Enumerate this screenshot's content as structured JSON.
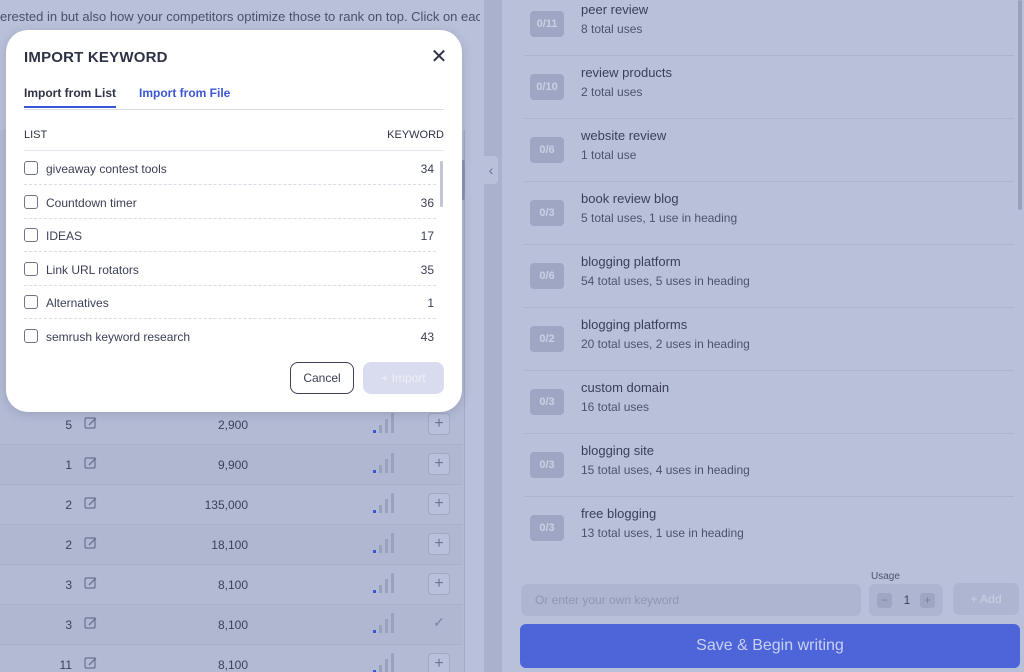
{
  "intro_text": "erested in but also how your competitors optimize those to rank on top. Click on each",
  "table_rows": [
    {
      "num": "5",
      "volume": "2,900",
      "action": "add"
    },
    {
      "num": "1",
      "volume": "9,900",
      "action": "add"
    },
    {
      "num": "2",
      "volume": "135,000",
      "action": "add"
    },
    {
      "num": "2",
      "volume": "18,100",
      "action": "add"
    },
    {
      "num": "3",
      "volume": "8,100",
      "action": "add"
    },
    {
      "num": "3",
      "volume": "8,100",
      "action": "added"
    },
    {
      "num": "11",
      "volume": "8,100",
      "action": "add"
    }
  ],
  "keywords": [
    {
      "badge": "0/11",
      "name": "peer review",
      "uses": "8 total uses"
    },
    {
      "badge": "0/10",
      "name": "review products",
      "uses": "2 total uses"
    },
    {
      "badge": "0/6",
      "name": "website review",
      "uses": "1 total use"
    },
    {
      "badge": "0/3",
      "name": "book review blog",
      "uses": "5 total uses, 1 use in heading"
    },
    {
      "badge": "0/6",
      "name": "blogging platform",
      "uses": "54 total uses, 5 uses in heading"
    },
    {
      "badge": "0/2",
      "name": "blogging platforms",
      "uses": "20 total uses, 2 uses in heading"
    },
    {
      "badge": "0/3",
      "name": "custom domain",
      "uses": "16 total uses"
    },
    {
      "badge": "0/3",
      "name": "blogging site",
      "uses": "15 total uses, 4 uses in heading"
    },
    {
      "badge": "0/3",
      "name": "free blogging",
      "uses": "13 total uses, 1 use in heading"
    }
  ],
  "own_keyword": {
    "placeholder": "Or enter your own keyword"
  },
  "usage": {
    "label": "Usage",
    "value": "1",
    "minus": "−",
    "plus": "+"
  },
  "add_label": "+ Add",
  "save_label": "Save & Begin writing",
  "collapse_glyph": "‹",
  "modal": {
    "title": "IMPORT KEYWORD",
    "close_glyph": "✕",
    "tabs": [
      "Import from List",
      "Import from File"
    ],
    "col_list": "LIST",
    "col_keyword": "KEYWORD",
    "lists": [
      {
        "name": "giveaway contest tools",
        "count": "34"
      },
      {
        "name": "Countdown timer",
        "count": "36"
      },
      {
        "name": "IDEAS",
        "count": "17"
      },
      {
        "name": "Link URL rotators",
        "count": "35"
      },
      {
        "name": "Alternatives",
        "count": "1"
      },
      {
        "name": "semrush keyword research",
        "count": "43"
      }
    ],
    "cancel_label": "Cancel",
    "import_label": "+ Import"
  },
  "colors": {
    "accent": "#3a56d4",
    "save_button": "#4d65d8",
    "overlay": "#b9c0d9"
  }
}
